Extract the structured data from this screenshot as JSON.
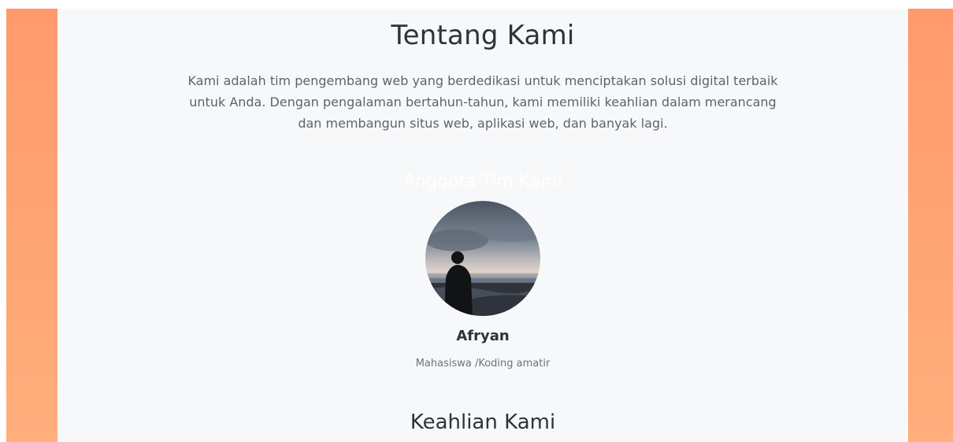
{
  "about": {
    "title": "Tentang Kami",
    "description": "Kami adalah tim pengembang web yang berdedikasi untuk menciptakan solusi digital terbaik untuk Anda. Dengan pengalaman bertahun-tahun, kami memiliki keahlian dalam merancang dan membangun situs web, aplikasi web, dan banyak lagi."
  },
  "team": {
    "heading": "Anggota Tim Kami",
    "members": [
      {
        "name": "Afryan",
        "role": "Mahasiswa /Koding amatir"
      }
    ]
  },
  "skills": {
    "heading": "Keahlian Kami"
  },
  "colors": {
    "side_gradient_top": "#ff9a6c",
    "side_gradient_bottom": "#ffae7c",
    "content_bg": "#f7f8fa",
    "heading_text": "#2f3338",
    "body_text": "#5f646a"
  }
}
